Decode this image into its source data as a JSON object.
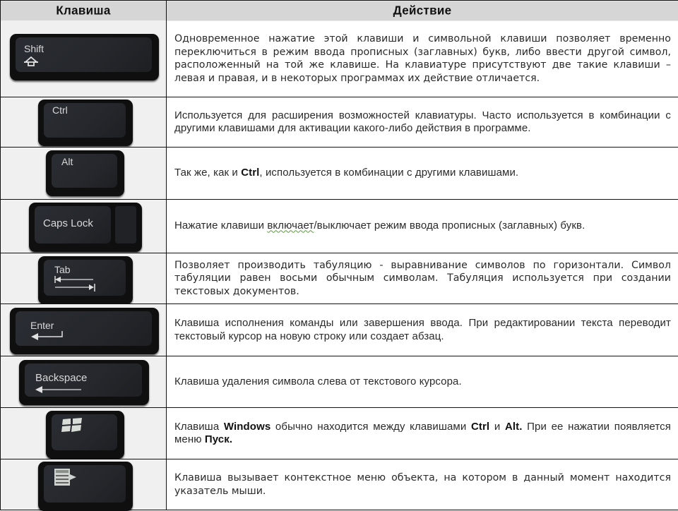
{
  "header": {
    "col_key": "Клавиша",
    "col_action": "Действие"
  },
  "rows": [
    {
      "key": "Shift",
      "icon": "shift-arrow-icon",
      "description": "Одновременное нажатие этой клавиши и символьной клавиши позволяет временно переключиться в режим ввода прописных (заглавных) букв, либо ввести другой символ, расположенный на той же клавише. На клавиатуре присутствуют две такие клавиши – левая и правая, и в некоторых программах их действие отличается."
    },
    {
      "key": "Ctrl",
      "description": "Используется для расширения возможностей клавиатуры. Часто используется в комбинации с другими клавишами для активации какого-либо действия в программе."
    },
    {
      "key": "Alt",
      "description_parts": [
        "Так же, как и ",
        "Ctrl",
        ", используется в комбинации с другими клавишами."
      ]
    },
    {
      "key": "Caps Lock",
      "description_parts": [
        "Нажатие клавиши ",
        "включает",
        "/выключает режим ввода прописных (заглавных) букв."
      ]
    },
    {
      "key": "Tab",
      "icon": "tab-arrows-icon",
      "description": "Позволяет производить табуляцию - выравнивание символов по горизонтали. Символ табуляции равен восьми обычным символам. Табуляция используется при создании текстовых документов."
    },
    {
      "key": "Enter",
      "icon": "enter-arrow-icon",
      "description": "Клавиша исполнения команды или завершения ввода. При редактировании текста переводит текстовый курсор на новую строку или создает абзац."
    },
    {
      "key": "Backspace",
      "icon": "backspace-arrow-icon",
      "description": "Клавиша удаления символа слева от текстового курсора."
    },
    {
      "key": "",
      "icon": "windows-logo-icon",
      "description_parts": [
        "Клавиша ",
        "Windows",
        " обычно находится между клавишами ",
        "Ctrl",
        " и ",
        "Alt.",
        " При ее нажатии появляется меню ",
        "Пуск."
      ]
    },
    {
      "key": "",
      "icon": "context-menu-icon",
      "description": "Клавиша вызывает контекстное меню объекта, на котором в данный момент находится указатель мыши."
    }
  ]
}
